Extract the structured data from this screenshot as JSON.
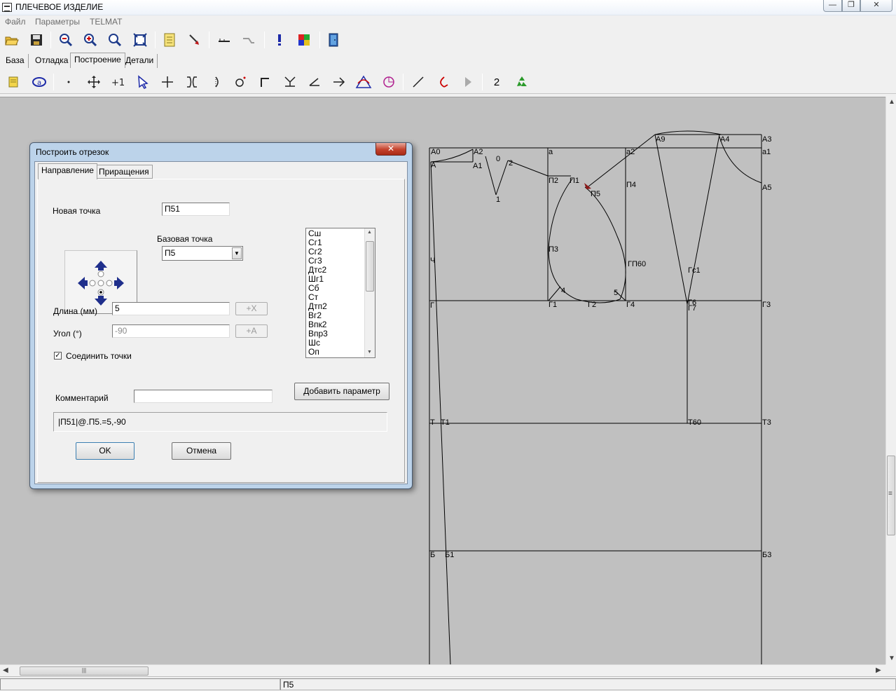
{
  "window": {
    "title": "ПЛЕЧЕВОЕ ИЗДЕЛИЕ",
    "min": "—",
    "max": "❐",
    "close": "✕"
  },
  "menu": [
    "Файл",
    "Параметры",
    "TELMAT"
  ],
  "tabs": [
    "База",
    "Отладка",
    "Построение",
    "Детали"
  ],
  "toolbar2": {
    "number_label": "2"
  },
  "dialog": {
    "title": "Построить отрезок",
    "close": "✕",
    "tabs": [
      "Направление",
      "Приращения"
    ],
    "new_point_label": "Новая точка",
    "new_point_value": "П51",
    "base_point_label": "Базовая точка",
    "base_point_value": "П5",
    "length_label": "Длина (мм)",
    "length_value": "5",
    "length_btn": "+X",
    "angle_label": "Угол (°)",
    "angle_value": "-90",
    "angle_btn": "+A",
    "connect_label": "Соединить точки",
    "connect_checked": true,
    "comment_label": "Комментарий",
    "comment_value": "",
    "add_param_btn": "Добавить параметр",
    "expression": "|П51|@.П5.=5,-90",
    "ok_btn": "OK",
    "cancel_btn": "Отмена",
    "points_list": [
      "Сш",
      "Сг1",
      "Сг2",
      "Сг3",
      "Дтс2",
      "Шг1",
      "Сб",
      "Ст",
      "Дтп2",
      "Вг2",
      "Впк2",
      "Впр3",
      "Шс",
      "Оп"
    ]
  },
  "drawing_labels": {
    "A0": "А0",
    "A2": "А2",
    "A": "А",
    "A1": "А1",
    "n0": "0",
    "n2": "2",
    "n1": "1",
    "a": "а",
    "a2": "а2",
    "A9": "А9",
    "A4": "А4",
    "A3": "А3",
    "a1": "а1",
    "A5": "А5",
    "P2": "П2",
    "P1": "П1",
    "P5": "П5",
    "P4": "П4",
    "P3": "П3",
    "GP60": "ГП60",
    "Gs1": "Гс1",
    "n4": "4",
    "n5": "5",
    "G": "Г",
    "G1": "Г1",
    "G2": "Г2",
    "G4": "Г4",
    "G6": "Г6",
    "G7": "Г7",
    "G3": "Г3",
    "Ch": "Ч",
    "T": "Т",
    "T1": "Т1",
    "T60": "Т60",
    "T3": "Т3",
    "B": "Б",
    "B1": "Б1",
    "B3": "Б3"
  },
  "scrollbars": {
    "h_grip": "|||",
    "v_grip": "≡",
    "up": "▲",
    "down": "▼",
    "left": "◀",
    "right": "▶"
  },
  "status": {
    "current_point": "П5"
  },
  "colors": {
    "canvas": "#c0c0c0",
    "dialog_frame": "#bcd3ea",
    "arrow": "#1f2f8c",
    "cursor_marker": "#8b1a1a"
  }
}
